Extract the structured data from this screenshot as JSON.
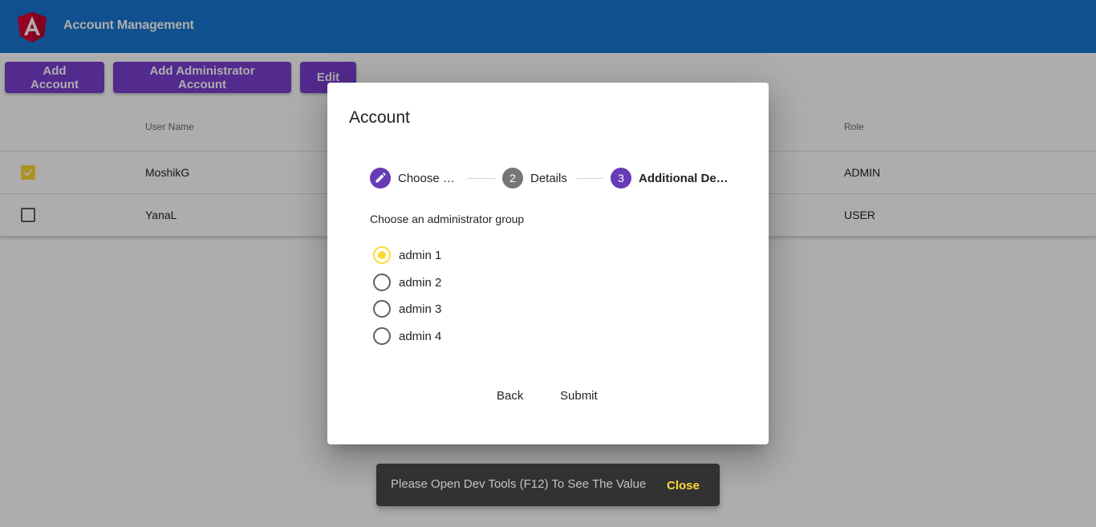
{
  "app": {
    "title": "Account Management"
  },
  "toolbar": {
    "add_account": "Add Account",
    "add_admin_account": "Add Administrator Account",
    "edit": "Edit"
  },
  "table": {
    "headers": {
      "user_name": "User Name",
      "role": "Role"
    },
    "rows": [
      {
        "checked": true,
        "user_name": "MoshikG",
        "role": "ADMIN"
      },
      {
        "checked": false,
        "user_name": "YanaL",
        "role": "USER"
      }
    ]
  },
  "dialog": {
    "title": "Account",
    "steps": [
      {
        "number": "",
        "label": "Choose S…",
        "icon": "pencil-icon",
        "state": "done"
      },
      {
        "number": "2",
        "label": "Details",
        "state": "inactive"
      },
      {
        "number": "3",
        "label": "Additional Det…",
        "state": "active"
      }
    ],
    "group_label": "Choose an administrator group",
    "options": [
      {
        "label": "admin 1",
        "checked": true
      },
      {
        "label": "admin 2",
        "checked": false
      },
      {
        "label": "admin 3",
        "checked": false
      },
      {
        "label": "admin 4",
        "checked": false
      }
    ],
    "back": "Back",
    "submit": "Submit"
  },
  "snackbar": {
    "message": "Please Open Dev Tools (F12) To See The Value",
    "action": "Close"
  },
  "colors": {
    "app_bar": "#1976d2",
    "button": "#7b3fd1",
    "step_active": "#673ab7",
    "step_inactive": "#757575",
    "accent": "#fdd835",
    "snackbar": "#323232"
  }
}
